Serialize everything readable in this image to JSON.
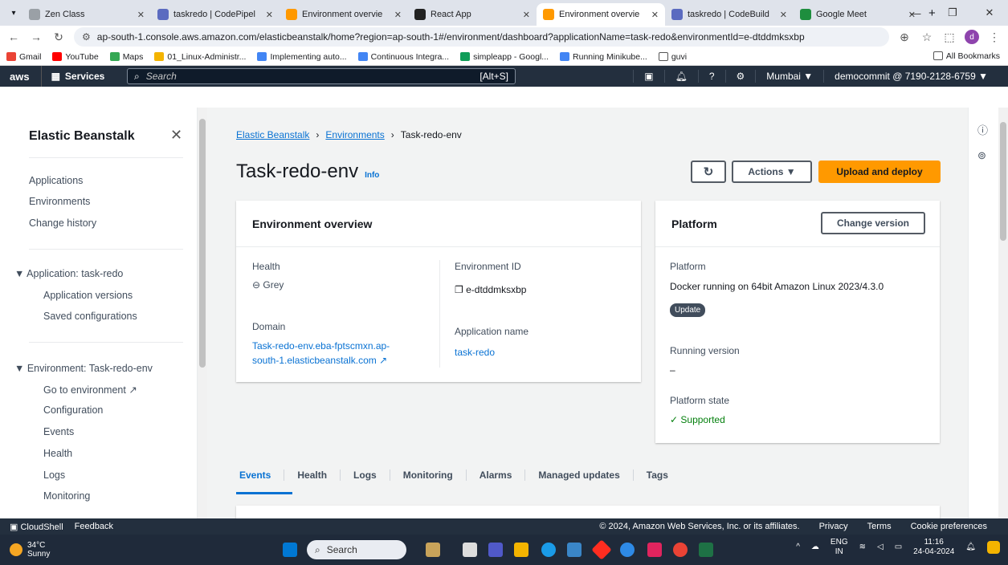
{
  "browser": {
    "tabs": [
      {
        "title": "Zen Class",
        "color": "#9aa0a6"
      },
      {
        "title": "taskredo | CodePipel",
        "color": "#5b6bc0"
      },
      {
        "title": "Environment overvie",
        "color": "#ff9900"
      },
      {
        "title": "React App",
        "color": "#222"
      },
      {
        "title": "Environment overvie",
        "color": "#ff9900"
      },
      {
        "title": "taskredo | CodeBuild",
        "color": "#5b6bc0"
      },
      {
        "title": "Google Meet",
        "color": "#1e8e3e"
      }
    ],
    "url": "ap-south-1.console.aws.amazon.com/elasticbeanstalk/home?region=ap-south-1#/environment/dashboard?applicationName=task-redo&environmentId=e-dtddmksxbp",
    "profile_initial": "d",
    "bookmarks": [
      "Gmail",
      "YouTube",
      "Maps",
      "01_Linux-Administr...",
      "Implementing auto...",
      "Continuous Integra...",
      "simpleapp - Googl...",
      "Running Minikube...",
      "guvi"
    ],
    "all_bookmarks": "All Bookmarks"
  },
  "aws": {
    "logo": "aws",
    "services": "Services",
    "search_placeholder": "Search",
    "search_shortcut": "[Alt+S]",
    "region": "Mumbai ▼",
    "account": "democommit @ 7190-2128-6759 ▼"
  },
  "sidebar": {
    "title": "Elastic Beanstalk",
    "top": [
      "Applications",
      "Environments",
      "Change history"
    ],
    "app_header": "▼  Application: task-redo",
    "app_items": [
      "Application versions",
      "Saved configurations"
    ],
    "env_header": "▼  Environment: Task-redo-env",
    "env_items": [
      "Go to environment",
      "Configuration",
      "Events",
      "Health",
      "Logs",
      "Monitoring"
    ]
  },
  "breadcrumb": [
    "Elastic Beanstalk",
    "Environments",
    "Task-redo-env"
  ],
  "page": {
    "title": "Task-redo-env",
    "info": "Info",
    "actions": "Actions ▼",
    "upload": "Upload and deploy"
  },
  "overview": {
    "heading": "Environment overview",
    "health_label": "Health",
    "health_value": "Grey",
    "domain_label": "Domain",
    "domain_line1": "Task-redo-env.eba-fptscmxn.ap-",
    "domain_line2": "south-1.elasticbeanstalk.com",
    "envid_label": "Environment ID",
    "envid_value": "e-dtddmksxbp",
    "appname_label": "Application name",
    "appname_value": "task-redo"
  },
  "platform": {
    "heading": "Platform",
    "change_version": "Change version",
    "platform_label": "Platform",
    "platform_value": "Docker running on 64bit Amazon Linux 2023/4.3.0",
    "update": "Update",
    "running_label": "Running version",
    "running_value": "–",
    "state_label": "Platform state",
    "state_value": "Supported"
  },
  "tabs": [
    "Events",
    "Health",
    "Logs",
    "Monitoring",
    "Alarms",
    "Managed updates",
    "Tags"
  ],
  "footer": {
    "cloudshell": "CloudShell",
    "feedback": "Feedback",
    "copyright": "© 2024, Amazon Web Services, Inc. or its affiliates.",
    "privacy": "Privacy",
    "terms": "Terms",
    "cookies": "Cookie preferences"
  },
  "taskbar": {
    "temp": "34°C",
    "weather": "Sunny",
    "search": "Search",
    "lang1": "ENG",
    "lang2": "IN",
    "time": "11:16",
    "date": "24-04-2024"
  }
}
